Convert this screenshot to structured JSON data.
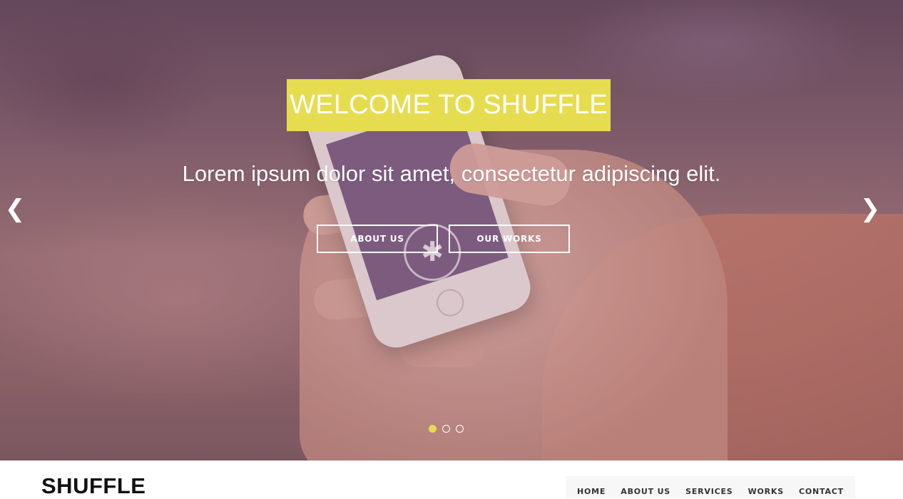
{
  "hero": {
    "title": "WELCOME TO SHUFFLE",
    "tagline": "Lorem ipsum dolor sit amet, consectetur adipiscing elit.",
    "buttons": {
      "about": "ABOUT US",
      "works": "OUR WORKS"
    },
    "prev_icon": "chevron-left-icon",
    "next_icon": "chevron-right-icon",
    "slides": {
      "count": 3,
      "active_index": 0
    },
    "accent_color": "#e6dc50"
  },
  "header": {
    "brand": "SHUFFLE",
    "nav": [
      "HOME",
      "ABOUT US",
      "SERVICES",
      "WORKS",
      "CONTACT"
    ]
  }
}
